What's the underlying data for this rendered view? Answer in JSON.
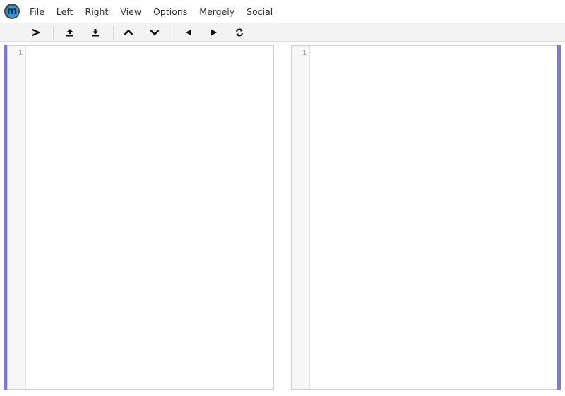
{
  "app": {
    "logo_letter": "m",
    "brand_color": "#2c9ad8",
    "margin_color": "#7b7bd6"
  },
  "menu": {
    "items": [
      "File",
      "Left",
      "Right",
      "View",
      "Options",
      "Mergely",
      "Social"
    ]
  },
  "toolbar": {
    "buttons": [
      {
        "name": "diff-icon"
      },
      {
        "name": "upload-icon"
      },
      {
        "name": "download-icon"
      },
      {
        "name": "previous-change-icon"
      },
      {
        "name": "next-change-icon"
      },
      {
        "name": "merge-left-icon"
      },
      {
        "name": "merge-right-icon"
      },
      {
        "name": "swap-icon"
      }
    ]
  },
  "editors": {
    "left": {
      "line_number": "1"
    },
    "right": {
      "line_number": "1"
    }
  }
}
